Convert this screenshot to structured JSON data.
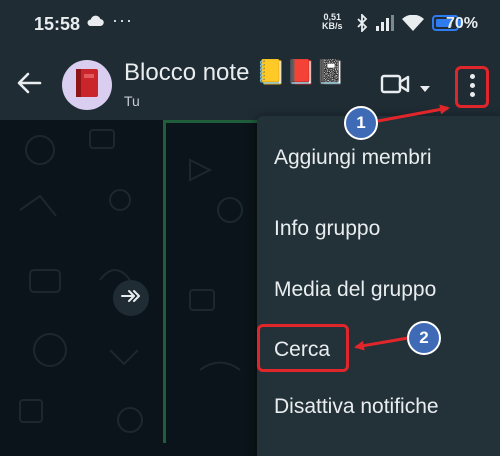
{
  "status_bar": {
    "time": "15:58",
    "net_speed_value": "0,51",
    "net_speed_unit": "KB/s",
    "battery_percent": "70%",
    "icons": [
      "cloud-icon",
      "more-dots-icon",
      "bluetooth-icon",
      "signal-icon",
      "wifi-icon",
      "battery-icon"
    ]
  },
  "header": {
    "title": "Blocco note 📒📕📓",
    "subtitle": "Tu",
    "icons": [
      "back-arrow-icon",
      "notebook-avatar-icon",
      "video-call-icon",
      "chevron-down-icon",
      "more-vert-icon"
    ]
  },
  "menu": {
    "items": [
      {
        "label": "Aggiungi membri"
      },
      {
        "label": "Info gruppo"
      },
      {
        "label": "Media del gruppo"
      },
      {
        "label": "Cerca"
      },
      {
        "label": "Disattiva notifiche"
      }
    ]
  },
  "annotations": {
    "step1": "1",
    "step2": "2",
    "highlight_color": "#e0262b",
    "badge_color": "#3f6bb6"
  },
  "colors": {
    "header_bg": "#1f2c34",
    "chat_bg": "#0b141a",
    "menu_bg": "#233138",
    "text": "#e9edef"
  }
}
